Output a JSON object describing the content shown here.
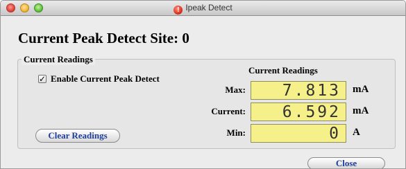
{
  "window": {
    "title": "Ipeak Detect",
    "title_icon": "alert-icon"
  },
  "page": {
    "title": "Current Peak Detect Site: 0"
  },
  "group": {
    "label": "Current Readings",
    "enable_checkbox": {
      "label": "Enable Current Peak Detect",
      "checked": true
    },
    "clear_button": "Clear Readings"
  },
  "readings": {
    "header": "Current Readings",
    "rows": [
      {
        "label": "Max:",
        "value": "7.813",
        "unit": "mA"
      },
      {
        "label": "Current:",
        "value": "6.592",
        "unit": "mA"
      },
      {
        "label": "Min:",
        "value": "0",
        "unit": "A"
      }
    ]
  },
  "footer": {
    "close_button": "Close"
  },
  "colors": {
    "display_bg": "#f5f089",
    "button_text": "#1f3d99"
  }
}
